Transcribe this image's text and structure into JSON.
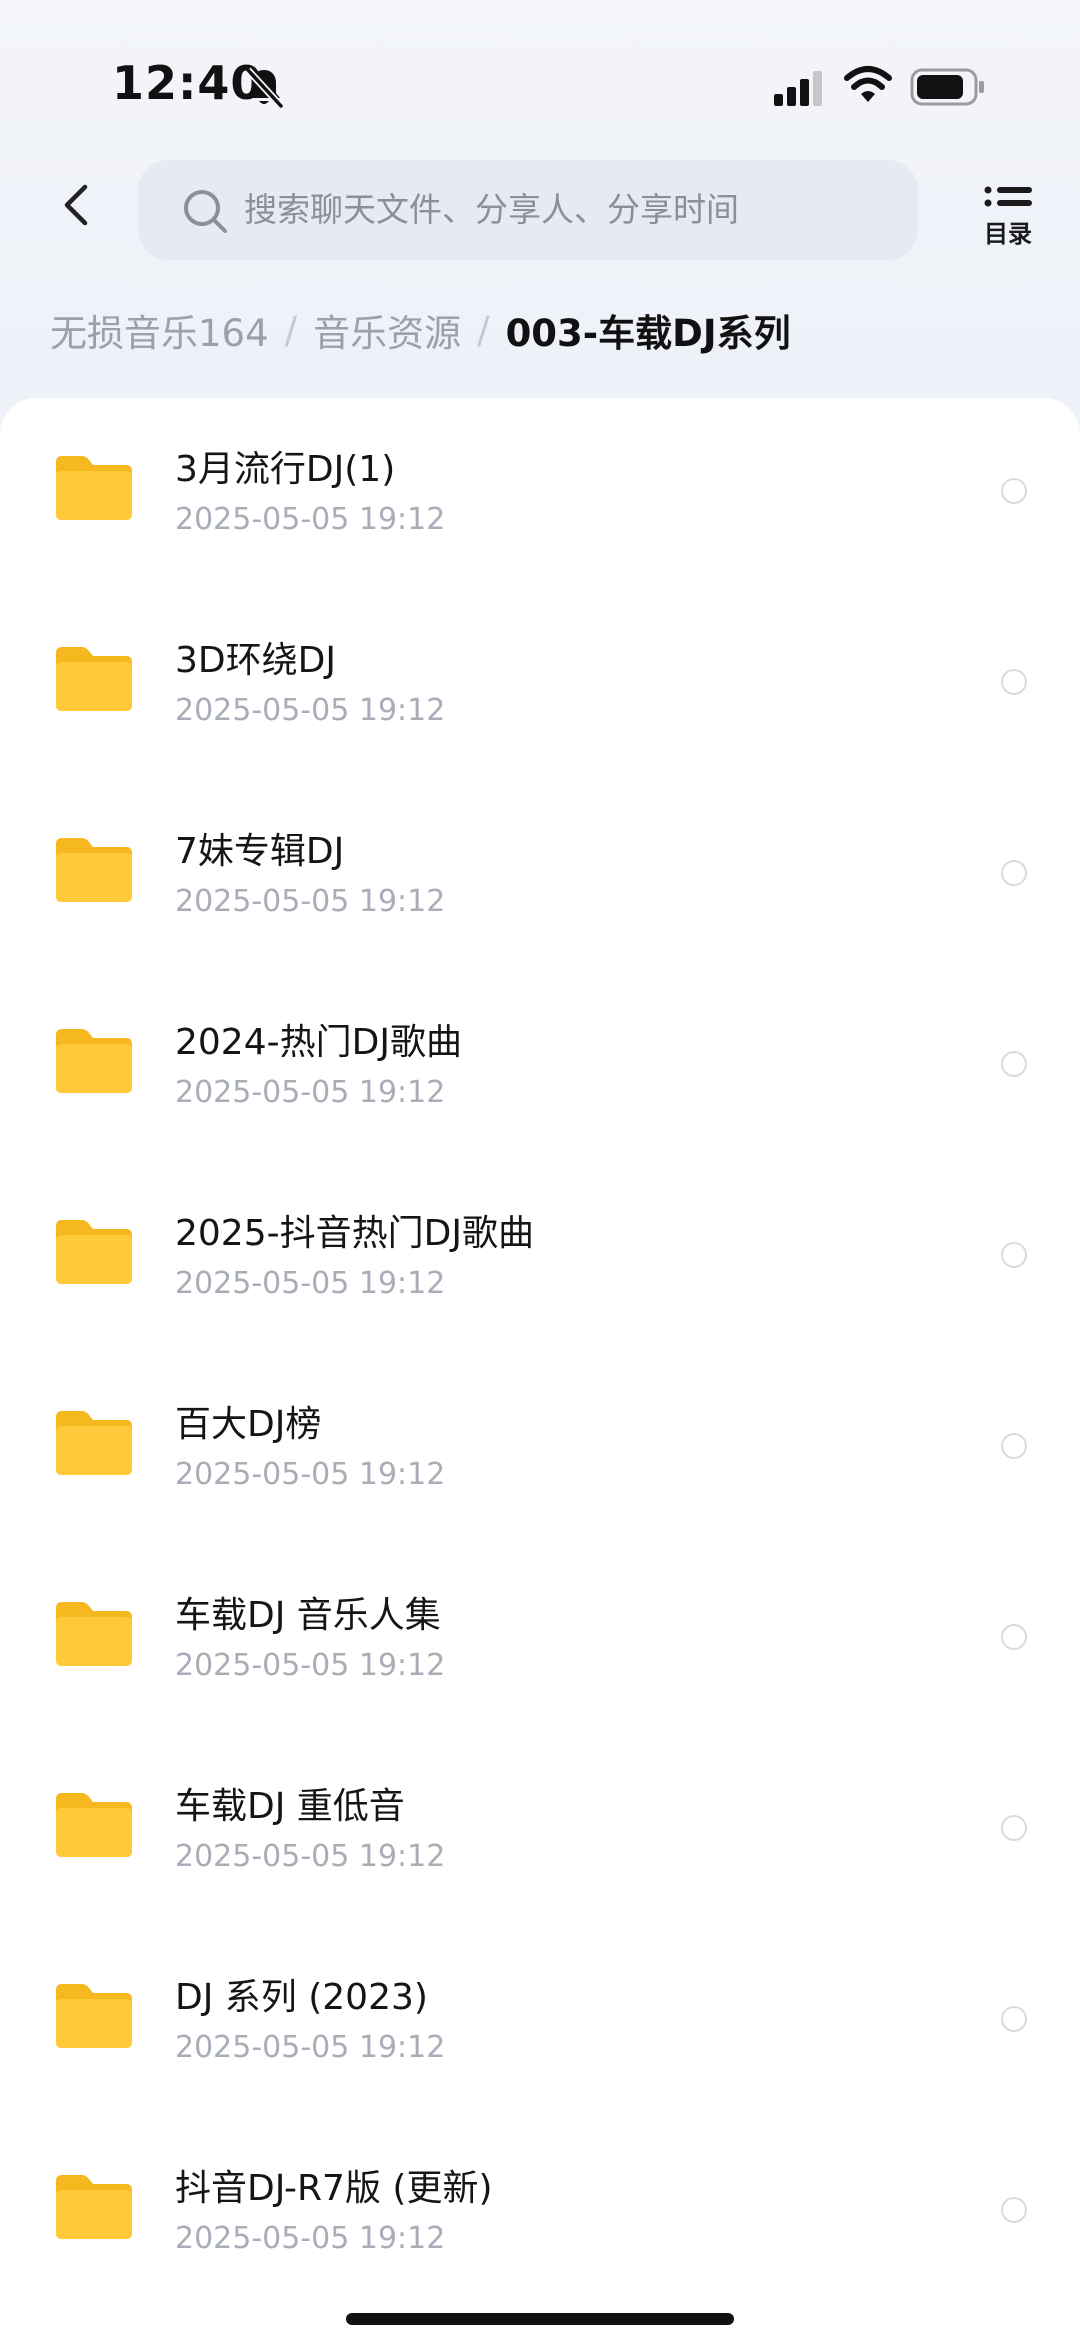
{
  "status_bar": {
    "time": "12:40",
    "icons": [
      "bell-slash-icon",
      "cellular-signal-icon",
      "wifi-icon",
      "battery-icon"
    ]
  },
  "header": {
    "back_icon": "chevron-left-icon",
    "search_placeholder": "搜索聊天文件、分享人、分享时间",
    "toc_label": "目录"
  },
  "breadcrumb": {
    "items": [
      "无损音乐164",
      "音乐资源",
      "003-车载DJ系列"
    ]
  },
  "files": [
    {
      "name": "3月流行DJ(1)",
      "date": "2025-05-05 19:12",
      "icon": "folder-icon"
    },
    {
      "name": "3D环绕DJ",
      "date": "2025-05-05 19:12",
      "icon": "folder-icon"
    },
    {
      "name": "7妹专辑DJ",
      "date": "2025-05-05 19:12",
      "icon": "folder-icon"
    },
    {
      "name": "2024-热门DJ歌曲",
      "date": "2025-05-05 19:12",
      "icon": "folder-icon"
    },
    {
      "name": "2025-抖音热门DJ歌曲",
      "date": "2025-05-05 19:12",
      "icon": "folder-icon"
    },
    {
      "name": "百大DJ榜",
      "date": "2025-05-05 19:12",
      "icon": "folder-icon"
    },
    {
      "name": "车载DJ 音乐人集",
      "date": "2025-05-05 19:12",
      "icon": "folder-icon"
    },
    {
      "name": "车载DJ 重低音",
      "date": "2025-05-05 19:12",
      "icon": "folder-icon"
    },
    {
      "name": "DJ 系列 (2023)",
      "date": "2025-05-05 19:12",
      "icon": "folder-icon"
    },
    {
      "name": "抖音DJ-R7版 (更新)",
      "date": "2025-05-05 19:12",
      "icon": "folder-icon"
    }
  ],
  "colors": {
    "folder": "#ffc93a",
    "folder_back": "#f6b81f",
    "muted_text": "#a8adb7",
    "panel": "#ffffff",
    "background": "#eef1f8"
  }
}
